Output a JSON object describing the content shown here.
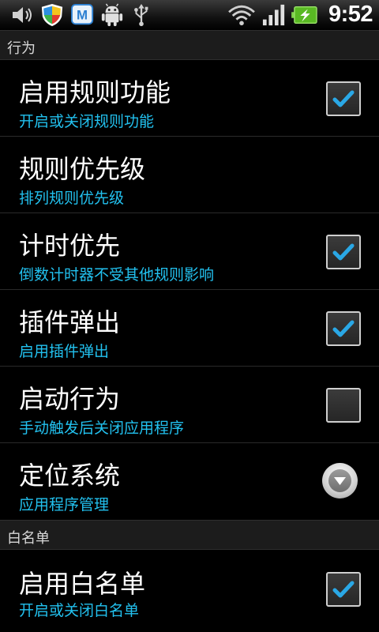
{
  "status_bar": {
    "time": "9:52",
    "icons": [
      "volume-icon",
      "shield-icon",
      "m-app-icon",
      "android-icon",
      "usb-icon",
      "wifi-icon",
      "signal-icon",
      "battery-charging-icon"
    ]
  },
  "sections": [
    {
      "label": "行为"
    },
    {
      "label": "白名单"
    }
  ],
  "preferences": [
    {
      "title": "启用规则功能",
      "summary": "开启或关闭规则功能",
      "widget": "checkbox",
      "checked": true
    },
    {
      "title": "规则优先级",
      "summary": "排列规则优先级",
      "widget": "none"
    },
    {
      "title": "计时优先",
      "summary": "倒数计时器不受其他规则影响",
      "widget": "checkbox",
      "checked": true
    },
    {
      "title": "插件弹出",
      "summary": "启用插件弹出",
      "widget": "checkbox",
      "checked": true
    },
    {
      "title": "启动行为",
      "summary": "手动触发后关闭应用程序",
      "widget": "checkbox",
      "checked": false
    },
    {
      "title": "定位系统",
      "summary": "应用程序管理",
      "widget": "dropdown"
    },
    {
      "title": "启用白名单",
      "summary": "开启或关闭白名单",
      "widget": "checkbox",
      "checked": true
    }
  ],
  "colors": {
    "summary_text": "#22c1ef",
    "checkmark": "#2aa8e6",
    "background": "#000000"
  }
}
